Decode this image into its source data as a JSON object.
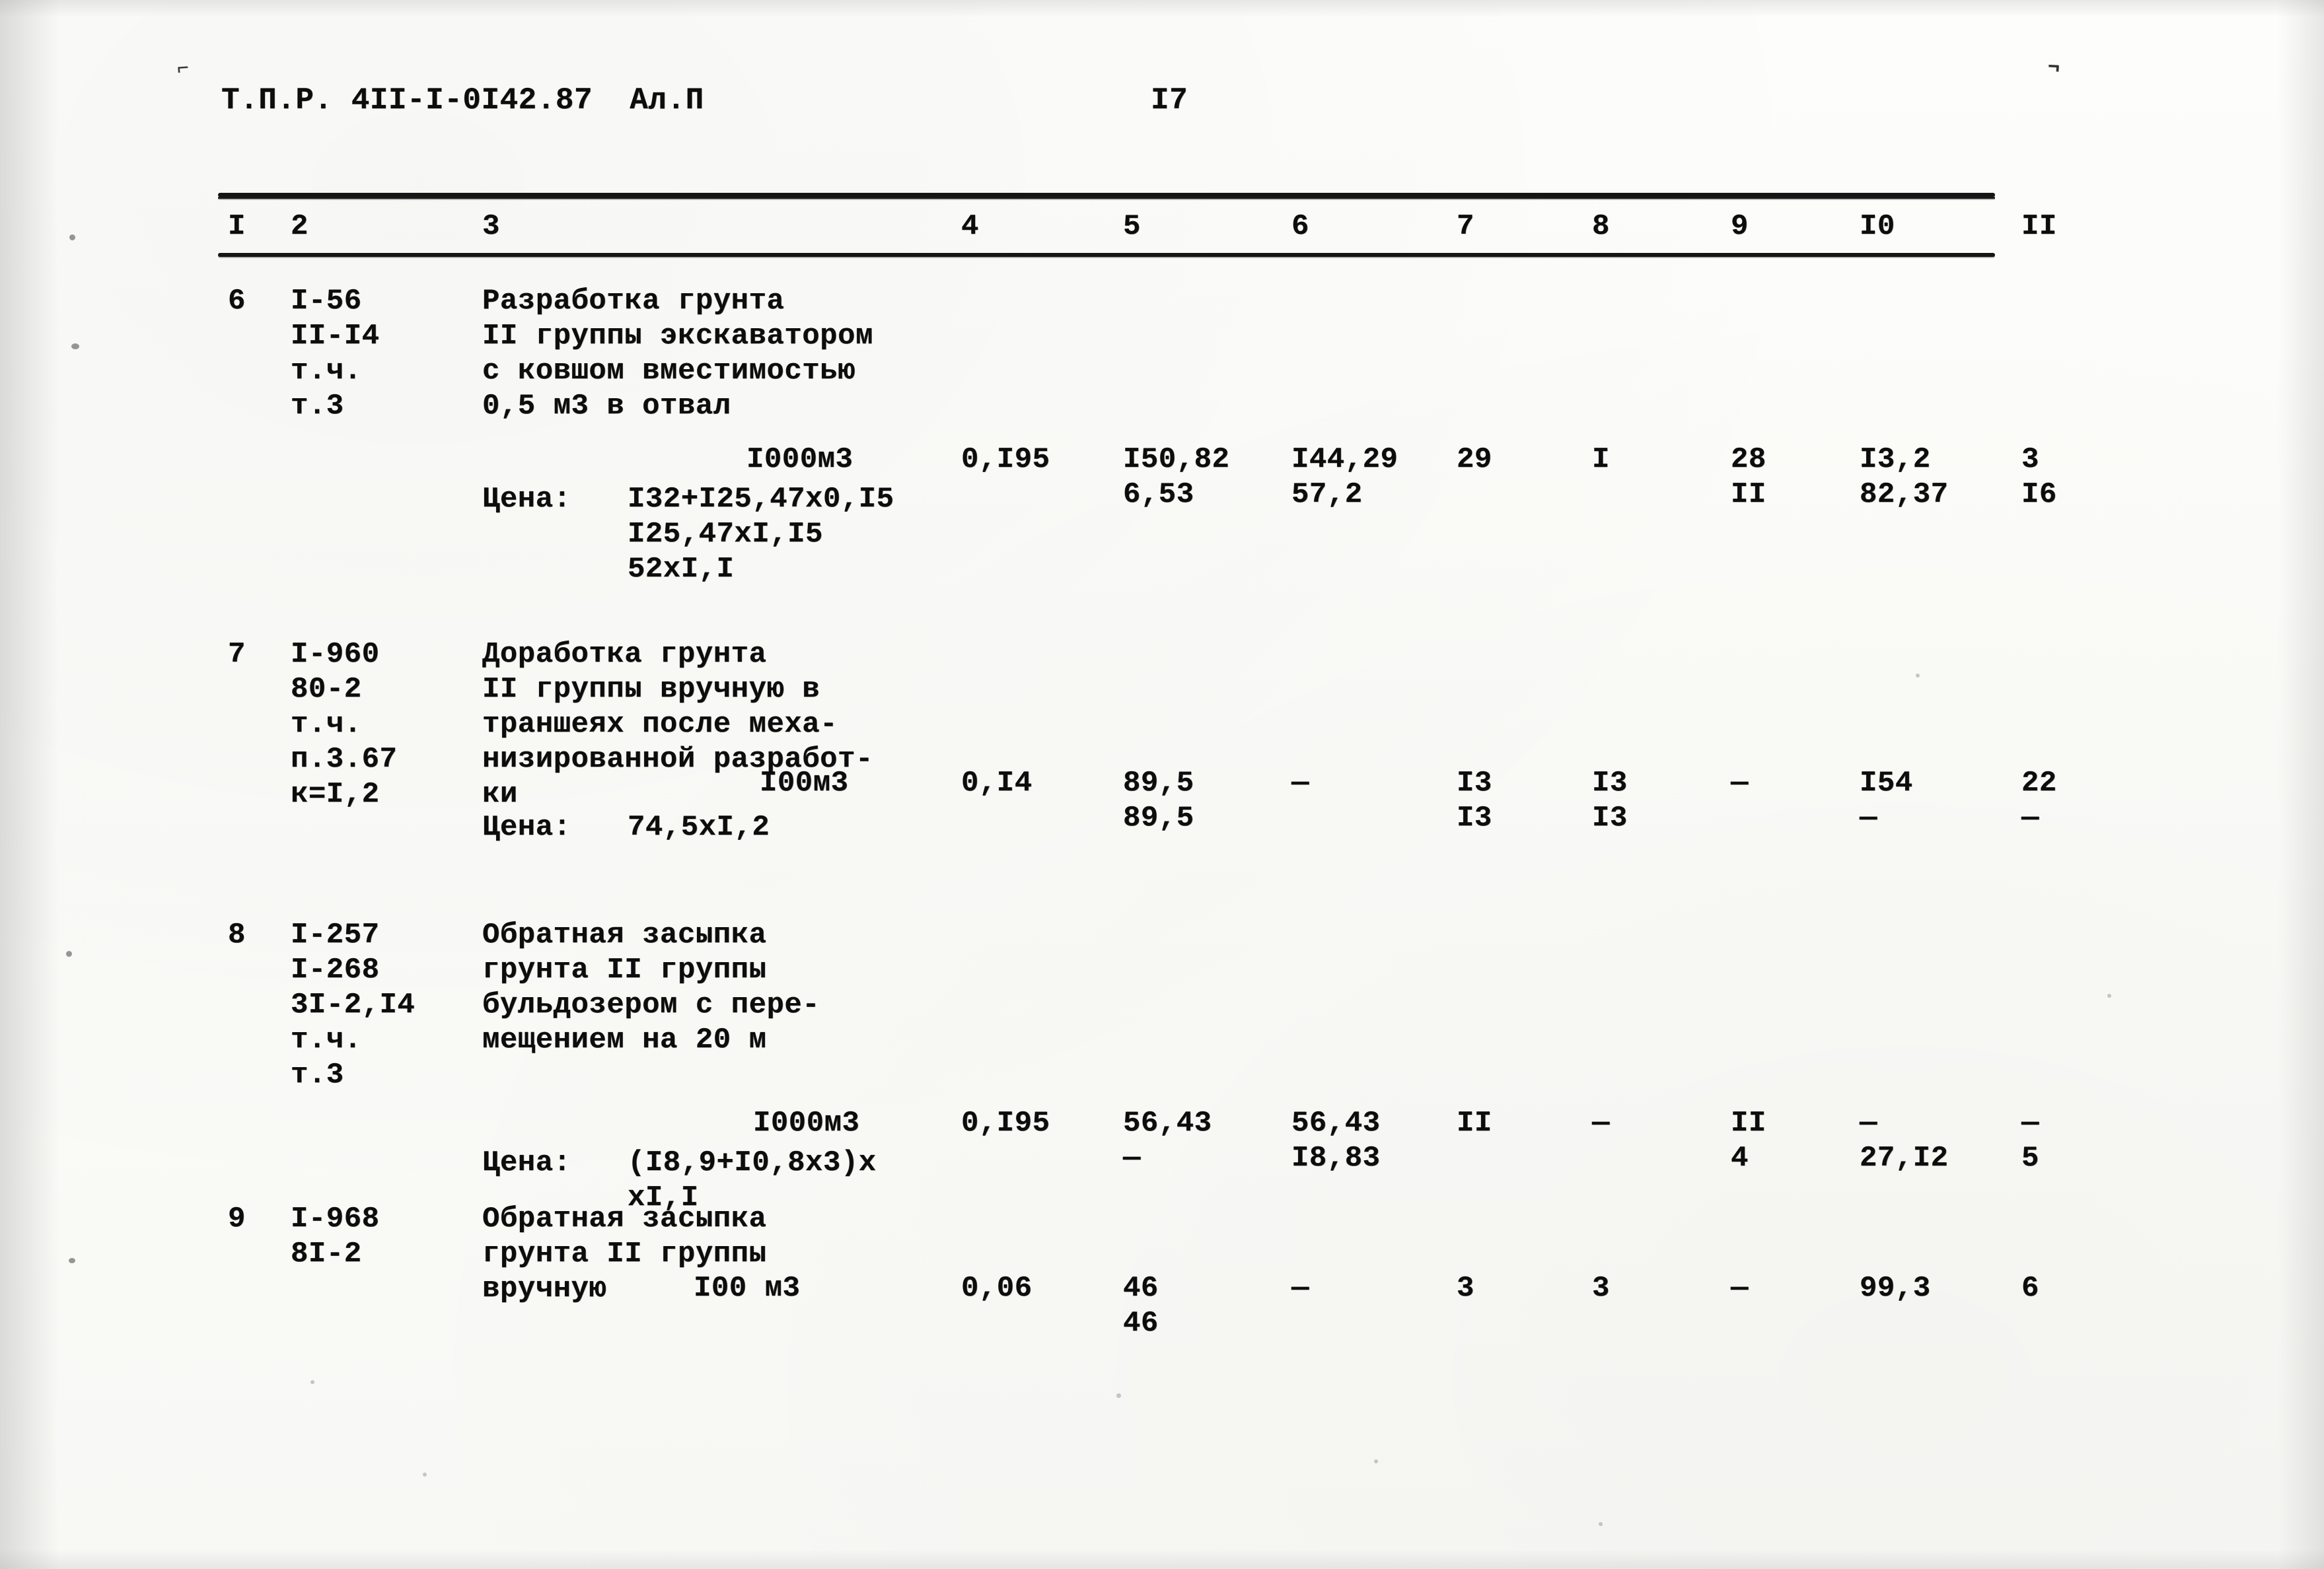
{
  "document": {
    "header_code": "Т.П.Р. 4II-I-0I42.87  Ал.П",
    "page_number": "I7"
  },
  "table": {
    "column_headers": [
      "I",
      "2",
      "3",
      "4",
      "5",
      "6",
      "7",
      "8",
      "9",
      "I0",
      "II"
    ],
    "rows": [
      {
        "num": "6",
        "codes": [
          "I-56",
          "II-I4",
          "т.ч.",
          "т.3"
        ],
        "description": [
          "Разработка грунта",
          "II группы экскаватором",
          "с ковшом вместимостью",
          "0,5 м3 в отвал"
        ],
        "unit": "I000м3",
        "price_label": "Цена:",
        "price_lines": [
          "I32+I25,47x0,I5",
          "I25,47xI,I5",
          "52xI,I"
        ],
        "col4": "0,I95",
        "col5": [
          "I50,82",
          "6,53"
        ],
        "col6": [
          "I44,29",
          "57,2"
        ],
        "col7": [
          "29",
          ""
        ],
        "col8": [
          "I",
          ""
        ],
        "col9": [
          "28",
          "II"
        ],
        "col10": [
          "I3,2",
          "82,37"
        ],
        "col11": [
          "3",
          "I6"
        ]
      },
      {
        "num": "7",
        "codes": [
          "I-960",
          "80-2",
          "т.ч.",
          "п.3.67",
          "к=I,2"
        ],
        "description": [
          "Доработка грунта",
          "II группы вручную в",
          "траншеях после меха-",
          "низированной разработ-",
          "ки"
        ],
        "unit": "I00м3",
        "price_label": "Цена:",
        "price_lines": [
          "74,5xI,2"
        ],
        "col4": "0,I4",
        "col5": [
          "89,5",
          "89,5"
        ],
        "col6": [
          "—",
          ""
        ],
        "col7": [
          "I3",
          "I3"
        ],
        "col8": [
          "I3",
          "I3"
        ],
        "col9": [
          "—",
          ""
        ],
        "col10": [
          "I54",
          "—"
        ],
        "col11": [
          "22",
          "—"
        ]
      },
      {
        "num": "8",
        "codes": [
          "I-257",
          "I-268",
          "3I-2,I4",
          "т.ч.",
          "т.3"
        ],
        "description": [
          "Обратная засыпка",
          "грунта II группы",
          "бульдозером с пере-",
          "мещением на 20 м"
        ],
        "unit": "I000м3",
        "price_label": "Цена:",
        "price_lines": [
          "(I8,9+I0,8x3)x",
          "xI,I"
        ],
        "col4": "0,I95",
        "col5": [
          "56,43",
          "—"
        ],
        "col6": [
          "56,43",
          "I8,83"
        ],
        "col7": [
          "II",
          ""
        ],
        "col8": [
          "—",
          ""
        ],
        "col9": [
          "II",
          "4"
        ],
        "col10": [
          "—",
          "27,I2"
        ],
        "col11": [
          "—",
          "5"
        ]
      },
      {
        "num": "9",
        "codes": [
          "I-968",
          "8I-2"
        ],
        "description": [
          "Обратная засыпка",
          "грунта II группы",
          "вручную"
        ],
        "unit": "I00 м3",
        "price_label": "",
        "price_lines": [],
        "col4": "0,06",
        "col5": [
          "46",
          "46"
        ],
        "col6": [
          "—",
          ""
        ],
        "col7": [
          "3",
          ""
        ],
        "col8": [
          "3",
          ""
        ],
        "col9": [
          "—",
          ""
        ],
        "col10": [
          "99,3",
          ""
        ],
        "col11": [
          "6",
          ""
        ]
      }
    ]
  }
}
